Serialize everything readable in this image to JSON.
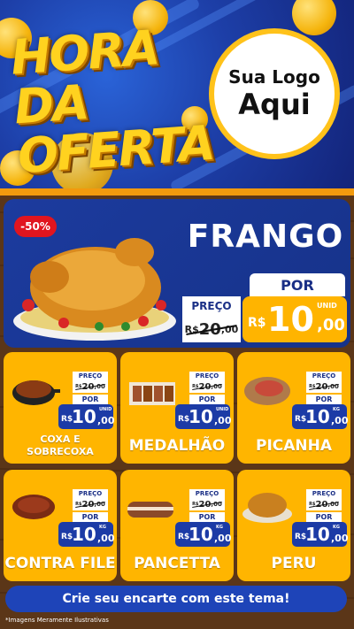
{
  "header": {
    "headline_line1": "HORA DA",
    "headline_line2": "OFERTA",
    "logo_line1": "Sua Logo",
    "logo_line2": "Aqui"
  },
  "featured": {
    "discount": "-50%",
    "name": "FRANGO",
    "preco_label": "PREÇO",
    "old_currency": "R$",
    "old_int": "20",
    "old_dec": ",00",
    "por_label": "POR",
    "new_currency": "R$",
    "new_int": "10",
    "new_dec": ",00",
    "unit": "UNID",
    "image_icon": "roast-chicken-icon"
  },
  "products": [
    {
      "name": "COXA E SOBRECOXA",
      "preco_label": "PREÇO",
      "old_currency": "R$",
      "old_int": "20",
      "old_dec": ",00",
      "por_label": "POR",
      "new_currency": "R$",
      "new_int": "10",
      "new_dec": ",00",
      "unit": "UNID",
      "icon": "chicken-leg-pan-icon"
    },
    {
      "name": "MEDALHÃO",
      "preco_label": "PREÇO",
      "old_currency": "R$",
      "old_int": "20",
      "old_dec": ",00",
      "por_label": "POR",
      "new_currency": "R$",
      "new_int": "10",
      "new_dec": ",00",
      "unit": "UNID",
      "icon": "skewers-icon"
    },
    {
      "name": "PICANHA",
      "preco_label": "PREÇO",
      "old_currency": "R$",
      "old_int": "20",
      "old_dec": ",00",
      "por_label": "POR",
      "new_currency": "R$",
      "new_int": "10",
      "new_dec": ",00",
      "unit": "KG",
      "icon": "picanha-board-icon"
    },
    {
      "name": "CONTRA FILE",
      "preco_label": "PREÇO",
      "old_currency": "R$",
      "old_int": "20",
      "old_dec": ",00",
      "por_label": "POR",
      "new_currency": "R$",
      "new_int": "10",
      "new_dec": ",00",
      "unit": "KG",
      "icon": "steak-icon"
    },
    {
      "name": "PANCETTA",
      "preco_label": "PREÇO",
      "old_currency": "R$",
      "old_int": "20",
      "old_dec": ",00",
      "por_label": "POR",
      "new_currency": "R$",
      "new_int": "10",
      "new_dec": ",00",
      "unit": "KG",
      "icon": "pancetta-icon"
    },
    {
      "name": "PERU",
      "preco_label": "PREÇO",
      "old_currency": "R$",
      "old_int": "20",
      "old_dec": ",00",
      "por_label": "POR",
      "new_currency": "R$",
      "new_int": "10",
      "new_dec": ",00",
      "unit": "KG",
      "icon": "roast-turkey-icon"
    }
  ],
  "cta_label": "Crie seu encarte com este tema!",
  "disclaimer": "*Imagens Meramente Ilustrativas",
  "colors": {
    "header_blue": "#1d3fa8",
    "card_yellow": "#ffb500",
    "price_blue": "#1c3ba6",
    "discount_red": "#e1151f",
    "wood_brown": "#5a3518"
  }
}
